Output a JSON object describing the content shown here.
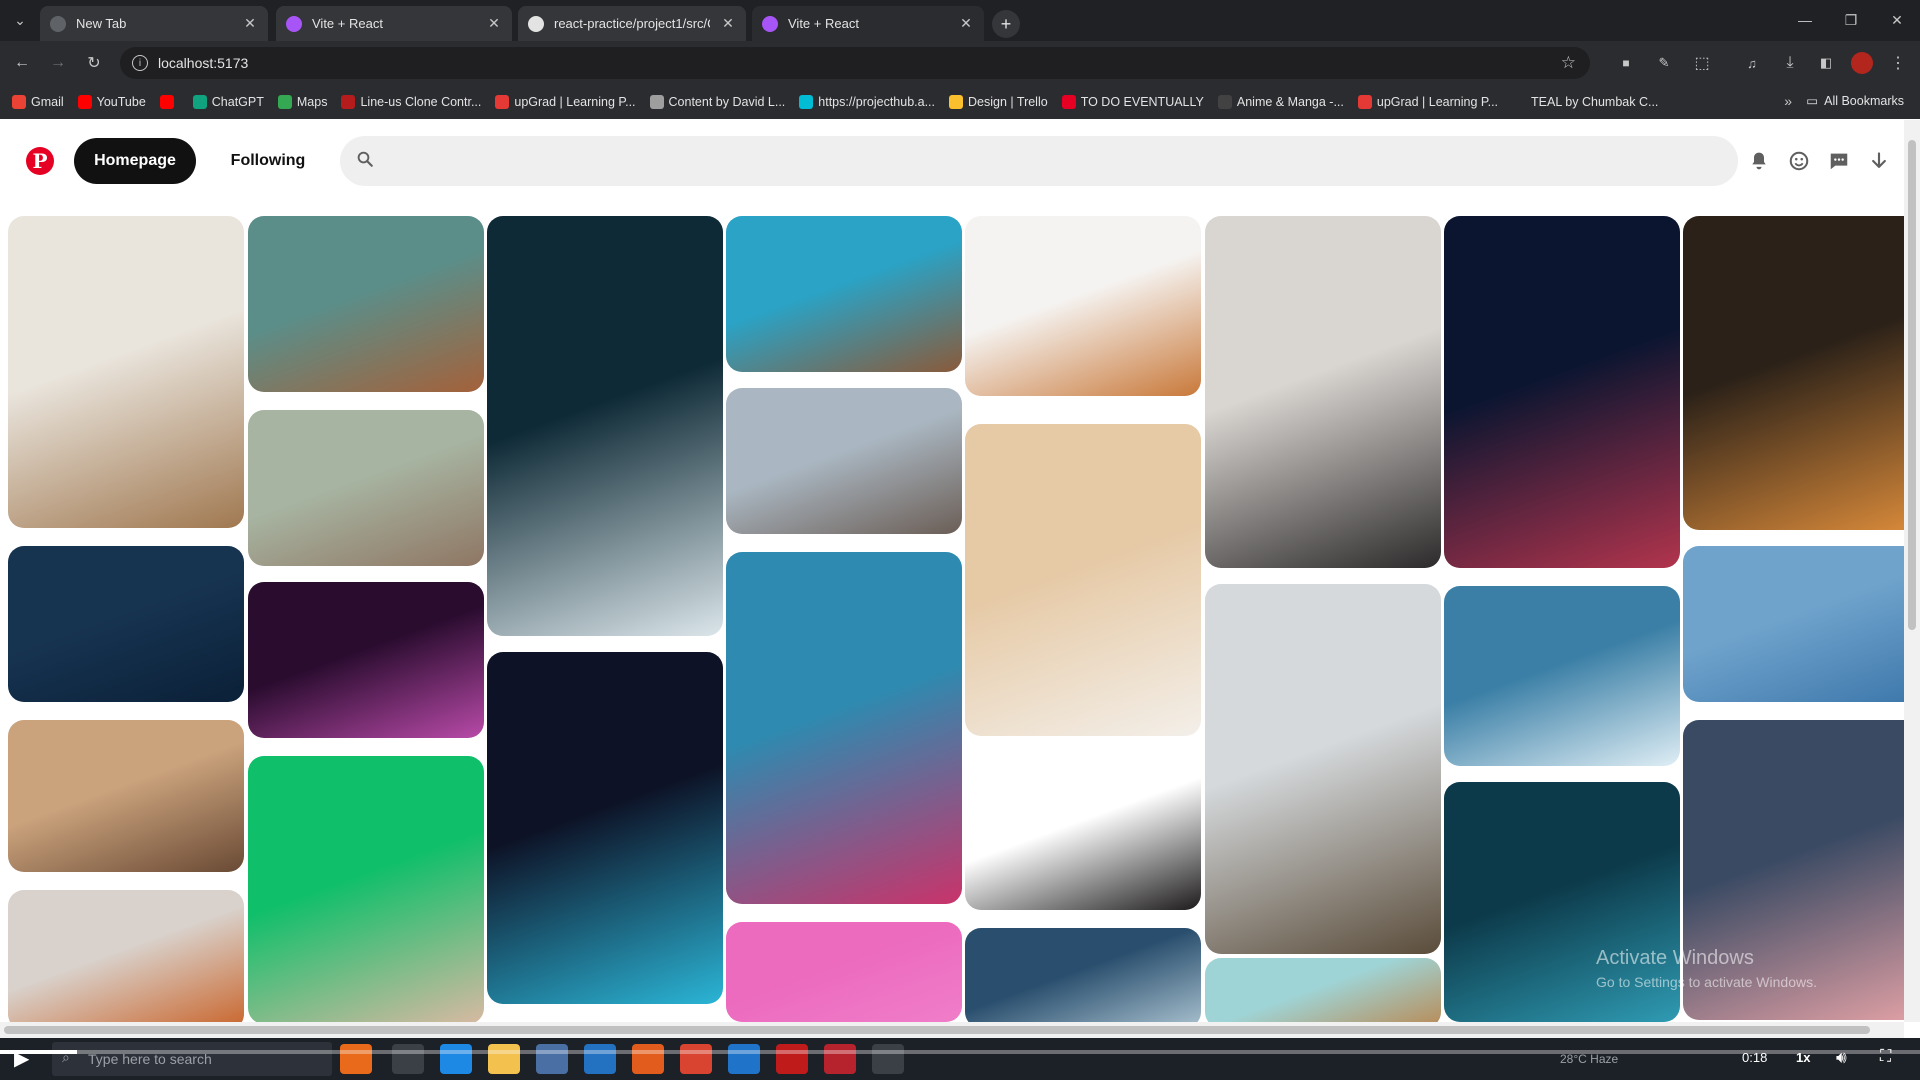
{
  "browser": {
    "tabs": [
      {
        "title": "New Tab",
        "favicon_color": "#5f6368",
        "active": false
      },
      {
        "title": "Vite + React",
        "favicon_color": "#a855f7",
        "active": false
      },
      {
        "title": "react-practice/project1/src/Con",
        "favicon_color": "#e3e3e3",
        "active": false
      },
      {
        "title": "Vite + React",
        "favicon_color": "#a855f7",
        "active": true
      }
    ],
    "url": "localhost:5173",
    "bookmarks": [
      {
        "label": "Gmail",
        "color": "#ea4335"
      },
      {
        "label": "YouTube",
        "color": "#ff0000"
      },
      {
        "label": "",
        "color": "#ff0000"
      },
      {
        "label": "ChatGPT",
        "color": "#10a37f"
      },
      {
        "label": "Maps",
        "color": "#34a853"
      },
      {
        "label": "Line-us Clone Contr...",
        "color": "#b71c1c"
      },
      {
        "label": "upGrad | Learning P...",
        "color": "#e53935"
      },
      {
        "label": "Content by David L...",
        "color": "#9e9e9e"
      },
      {
        "label": "https://projecthub.a...",
        "color": "#00bcd4"
      },
      {
        "label": "Design | Trello",
        "color": "#fbc02d"
      },
      {
        "label": "TO DO EVENTUALLY",
        "color": "#e60023"
      },
      {
        "label": "Anime & Manga -...",
        "color": "#424242"
      },
      {
        "label": "upGrad | Learning P...",
        "color": "#e53935"
      },
      {
        "label": "TEAL by Chumbak C...",
        "color": "#2b2c30"
      }
    ],
    "all_bookmarks_label": "All Bookmarks"
  },
  "pinterest": {
    "brand_color": "#e60023",
    "logo_letter": "P",
    "nav": {
      "home_label": "Homepage",
      "following_label": "Following"
    },
    "search": {
      "placeholder": ""
    },
    "pins": [
      {
        "name": "cat-sleeping-bed",
        "colors": [
          "#e9e4dc",
          "#a07850"
        ]
      },
      {
        "name": "kitten-wood-floor",
        "colors": [
          "#5b8e89",
          "#a4613a"
        ]
      },
      {
        "name": "ocean-waves-aerial",
        "colors": [
          "#0e2a36",
          "#dbe6ea"
        ]
      },
      {
        "name": "dogs-blue-sky",
        "colors": [
          "#2aa3c6",
          "#8a5a3a"
        ]
      },
      {
        "name": "kittens-basket",
        "colors": [
          "#f5f3f1",
          "#c9793a"
        ]
      },
      {
        "name": "white-black-dogs-rug",
        "colors": [
          "#d9d6d2",
          "#2c2a2a"
        ]
      },
      {
        "name": "neon-street-night",
        "colors": [
          "#0b1530",
          "#b2344d"
        ]
      },
      {
        "name": "alley-lanterns",
        "colors": [
          "#2b2118",
          "#d98a3a"
        ]
      },
      {
        "name": "sea-surface-1",
        "colors": [
          "#2a4f6e",
          "#a9c1cf"
        ]
      },
      {
        "name": "sea-horizon",
        "colors": [
          "#6fa3cc",
          "#3d77ab"
        ]
      },
      {
        "name": "deep-sea",
        "colors": [
          "#163350",
          "#0b2038"
        ]
      },
      {
        "name": "puppies-gravel",
        "colors": [
          "#a7b4a1",
          "#8e7663"
        ]
      },
      {
        "name": "purple-street",
        "colors": [
          "#2a0c2f",
          "#b84aa8"
        ]
      },
      {
        "name": "city-neon-crossing",
        "colors": [
          "#2e8ab0",
          "#c9336a"
        ]
      },
      {
        "name": "cherry-tree-street",
        "colors": [
          "#aab7c2",
          "#6b5e56"
        ]
      },
      {
        "name": "frenchie-green",
        "colors": [
          "#0fbf6a",
          "#d8b9a2"
        ]
      },
      {
        "name": "tokyo-tower-neon",
        "colors": [
          "#0d1226",
          "#2bb5d6"
        ]
      },
      {
        "name": "corgi-dogs-running",
        "colors": [
          "#caa27c",
          "#6a4a35"
        ]
      },
      {
        "name": "black-dog-white",
        "colors": [
          "#ffffff",
          "#1d1b1b"
        ]
      },
      {
        "name": "tabby-cat-portrait",
        "colors": [
          "#d5d9dc",
          "#5a4c3a"
        ]
      },
      {
        "name": "icy-ocean",
        "colors": [
          "#3b7fa6",
          "#dfeef5"
        ]
      },
      {
        "name": "beach-sand",
        "colors": [
          "#e6c9a5",
          "#f3efe9"
        ]
      },
      {
        "name": "orange-cat-building",
        "colors": [
          "#d9d1cb",
          "#c9642a"
        ]
      },
      {
        "name": "kitten-reaching",
        "colors": [
          "#9fd4d6",
          "#b98a55"
        ]
      },
      {
        "name": "ocean-teal",
        "colors": [
          "#0c3a4a",
          "#2f9bb3"
        ]
      },
      {
        "name": "sunset-sea",
        "colors": [
          "#3a4a63",
          "#e0a0a5"
        ]
      },
      {
        "name": "pink-solid",
        "colors": [
          "#ec6bbf",
          "#f07dc9"
        ]
      }
    ]
  },
  "taskbar": {
    "search_placeholder": "Type here to search",
    "video_time": "0:18",
    "video_speed": "1x",
    "video_progress": 0.04,
    "weather": "28°C  Haze",
    "watermark_line1": "Activate Windows",
    "watermark_line2": "Go to Settings to activate Windows."
  }
}
